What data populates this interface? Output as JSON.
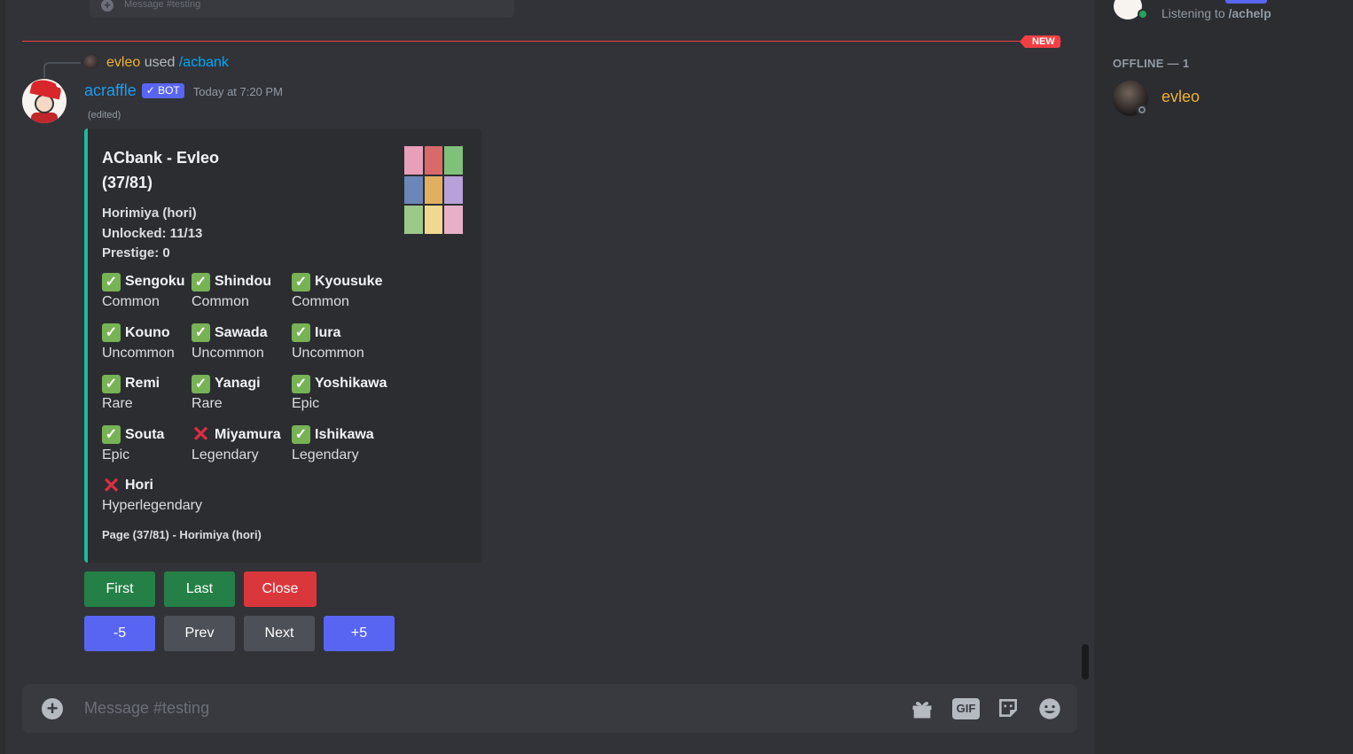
{
  "previous_input": {
    "placeholder": "Message #testing"
  },
  "divider": {
    "badge": "NEW"
  },
  "reply": {
    "user": "evleo",
    "used": "used",
    "command": "/acbank"
  },
  "message": {
    "author": "acraffle",
    "bot_tag": "✓ BOT",
    "timestamp": "Today at 7:20 PM",
    "edited": "(edited)"
  },
  "embed": {
    "accent_color": "#1abc9c",
    "title": "ACbank - Evleo (37/81)",
    "series": "Horimiya (hori)",
    "unlocked": "Unlocked: 11/13",
    "prestige": "Prestige: 0",
    "footer": "Page (37/81) - Horimiya (hori)",
    "characters": [
      {
        "name": "Sengoku",
        "rarity": "Common",
        "unlocked": true
      },
      {
        "name": "Shindou",
        "rarity": "Common",
        "unlocked": true
      },
      {
        "name": "Kyousuke",
        "rarity": "Common",
        "unlocked": true
      },
      {
        "name": "Kouno",
        "rarity": "Uncommon",
        "unlocked": true
      },
      {
        "name": "Sawada",
        "rarity": "Uncommon",
        "unlocked": true
      },
      {
        "name": "Iura",
        "rarity": "Uncommon",
        "unlocked": true
      },
      {
        "name": "Remi",
        "rarity": "Rare",
        "unlocked": true
      },
      {
        "name": "Yanagi",
        "rarity": "Rare",
        "unlocked": true
      },
      {
        "name": "Yoshikawa",
        "rarity": "Epic",
        "unlocked": true
      },
      {
        "name": "Souta",
        "rarity": "Epic",
        "unlocked": true
      },
      {
        "name": "Miyamura",
        "rarity": "Legendary",
        "unlocked": false
      },
      {
        "name": "Ishikawa",
        "rarity": "Legendary",
        "unlocked": true
      },
      {
        "name": "Hori",
        "rarity": "Hyperlegendary",
        "unlocked": false
      }
    ]
  },
  "buttons": {
    "row1": [
      {
        "label": "First",
        "style": "green"
      },
      {
        "label": "Last",
        "style": "green"
      },
      {
        "label": "Close",
        "style": "red"
      }
    ],
    "row2": [
      {
        "label": "-5",
        "style": "blurple"
      },
      {
        "label": "Prev",
        "style": "gray"
      },
      {
        "label": "Next",
        "style": "gray"
      },
      {
        "label": "+5",
        "style": "blurple"
      }
    ]
  },
  "composer": {
    "placeholder": "Message #testing",
    "gif_label": "GIF",
    "icons": [
      "add-icon",
      "gift-icon",
      "gif-icon",
      "sticker-icon",
      "emoji-icon"
    ]
  },
  "members": {
    "online_activity_prefix": "Listening to",
    "online_activity_value": "/achelp",
    "offline_header": "OFFLINE — 1",
    "offline_user": "evleo"
  },
  "colors": {
    "check": "#77b255",
    "cross": "#dd2e44",
    "new": "#f23f43",
    "link": "#00a8fc"
  }
}
